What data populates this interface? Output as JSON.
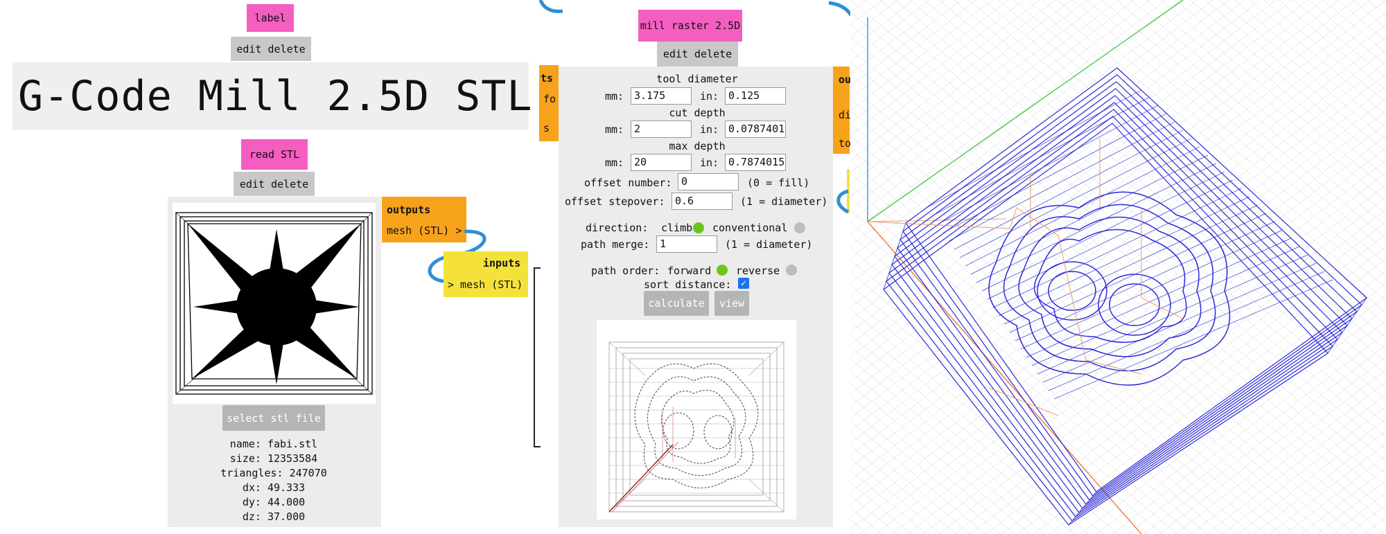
{
  "left": {
    "label_node": {
      "title": "label",
      "edit": "edit",
      "delete": "delete"
    },
    "big_label": "G-Code Mill 2.5D STL",
    "read_node": {
      "title": "read STL",
      "edit": "edit",
      "delete": "delete",
      "outputs_title": "outputs",
      "output_port": "mesh (STL) >",
      "select_button": "select stl file",
      "info": {
        "name": "name: fabi.stl",
        "size": "size: 12353584",
        "triangles": "triangles: 247070",
        "dx": "dx: 49.333",
        "dy": "dy: 44.000",
        "dz": "dz: 37.000"
      }
    },
    "inputs_node": {
      "title": "inputs",
      "input_port": "> mesh (STL)"
    }
  },
  "middle": {
    "title": "mill raster 2.5D",
    "edit": "edit",
    "delete": "delete",
    "left_outputs_partial": {
      "title": "ts",
      "items": [
        "fo",
        "s"
      ]
    },
    "right_outputs_partial": {
      "title": "ou",
      "items": [
        "di",
        "to"
      ]
    },
    "tool_diameter": {
      "label": "tool diameter",
      "mm_label": "mm:",
      "mm": "3.175",
      "in_label": "in:",
      "in": "0.125"
    },
    "cut_depth": {
      "label": "cut depth",
      "mm_label": "mm:",
      "mm": "2",
      "in_label": "in:",
      "in": "0.0787401"
    },
    "max_depth": {
      "label": "max depth",
      "mm_label": "mm:",
      "mm": "20",
      "in_label": "in:",
      "in": "0.7874015"
    },
    "offset_number": {
      "label": "offset number:",
      "value": "0",
      "hint": "(0 = fill)"
    },
    "offset_stepover": {
      "label": "offset stepover:",
      "value": "0.6",
      "hint": "(1 = diameter)"
    },
    "direction": {
      "label": "direction:",
      "opt1": "climb",
      "opt2": "conventional",
      "selected": "climb"
    },
    "path_merge": {
      "label": "path merge:",
      "value": "1",
      "hint": "(1 = diameter)"
    },
    "path_order": {
      "label": "path order:",
      "opt1": "forward",
      "opt2": "reverse",
      "selected": "forward"
    },
    "sort_distance": {
      "label": "sort distance:",
      "checked": true
    },
    "calculate_button": "calculate",
    "view_button": "view"
  },
  "colors": {
    "pink": "#f45ec0",
    "orange": "#f7a21b",
    "yellow": "#f4e23a",
    "wire_blue": "#2f8fd6",
    "radio_on": "#6cc61a",
    "radio_off": "#bdbdbd",
    "toolpath_blue": "#2a2ad8",
    "grid_axis_x": "#f07a3a",
    "grid_axis_y": "#46c84a",
    "grid_axis_z": "#3b8ee8"
  }
}
